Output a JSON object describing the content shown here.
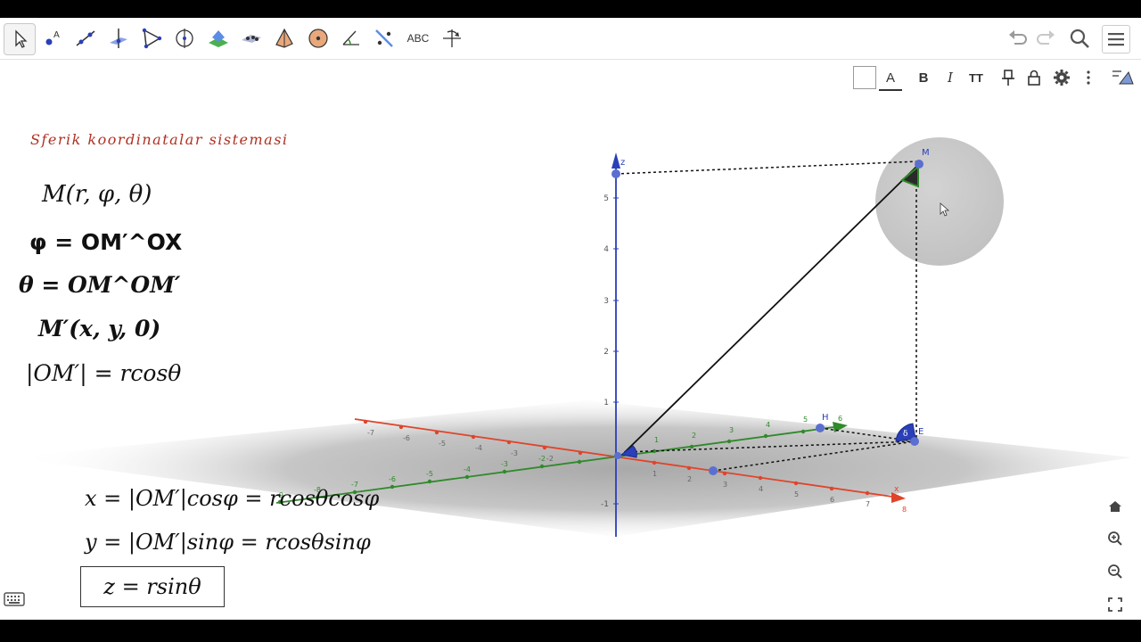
{
  "toolbar": {
    "tools": [
      {
        "id": "move",
        "icon": "cursor-arrow-icon"
      },
      {
        "id": "point",
        "icon": "point-icon"
      },
      {
        "id": "line",
        "icon": "line-icon"
      },
      {
        "id": "perpendicular",
        "icon": "perpendicular-line-icon"
      },
      {
        "id": "polygon",
        "icon": "polygon-icon"
      },
      {
        "id": "circle-axis",
        "icon": "circle-around-axis-icon"
      },
      {
        "id": "intersect-surfaces",
        "icon": "intersect-surfaces-icon"
      },
      {
        "id": "plane",
        "icon": "plane-icon"
      },
      {
        "id": "pyramid",
        "icon": "pyramid-icon"
      },
      {
        "id": "sphere",
        "icon": "sphere-icon"
      },
      {
        "id": "angle",
        "icon": "angle-icon"
      },
      {
        "id": "reflect",
        "icon": "reflect-icon"
      },
      {
        "id": "text",
        "label": "ABC",
        "icon": "text-icon"
      },
      {
        "id": "rotate-view",
        "icon": "rotate-view-icon"
      }
    ],
    "right": [
      "undo-icon",
      "redo-icon",
      "search-icon",
      "menu-icon"
    ]
  },
  "style_bar": {
    "text_label": "A",
    "bold_label": "B",
    "italic_label": "I",
    "size_label": "TT"
  },
  "title": "Sferik koordinatalar sistemasi",
  "formulas": {
    "m_def": "M(r, φ, θ)",
    "phi_def": "φ = OM′^OX",
    "theta_def": "θ = OM^OM′",
    "m_prime": "M′(x, y, 0)",
    "om_prime": "|OM′| = rcosθ",
    "x_eq": "x = |OM′|cosφ = rcosθcosφ",
    "y_eq": "y = |OM′|sinφ = rcosθsinφ",
    "z_eq": "z = rsinθ"
  },
  "scene": {
    "z_axis_label": "z",
    "x_axis_label": "x",
    "y_axis_label": "y",
    "point_M": "M",
    "point_H": "H",
    "point_E": "E",
    "angle_delta": "δ",
    "angle_theta": "θ",
    "z_ticks": [
      "5",
      "4",
      "3",
      "2",
      "1",
      "-1"
    ],
    "x_ticks": [
      "1",
      "2",
      "3",
      "4",
      "5",
      "6",
      "7",
      "8",
      "-1",
      "-2",
      "-3",
      "-4",
      "-5",
      "-6",
      "-7"
    ],
    "y_ticks": [
      "1",
      "2",
      "3",
      "4",
      "5",
      "6",
      "-1",
      "-2",
      "-3",
      "-4",
      "-5",
      "-6",
      "-7",
      "-8",
      "-9"
    ],
    "colors": {
      "x_axis": "#e0442a",
      "y_axis": "#2f8a2a",
      "z_axis": "#2a3fb8",
      "plane": "#bdbdbd",
      "sphere": "#c9c9c9"
    }
  },
  "bottom_right_controls": [
    "home-icon",
    "zoom-in-icon",
    "zoom-out-icon",
    "fullscreen-icon"
  ]
}
